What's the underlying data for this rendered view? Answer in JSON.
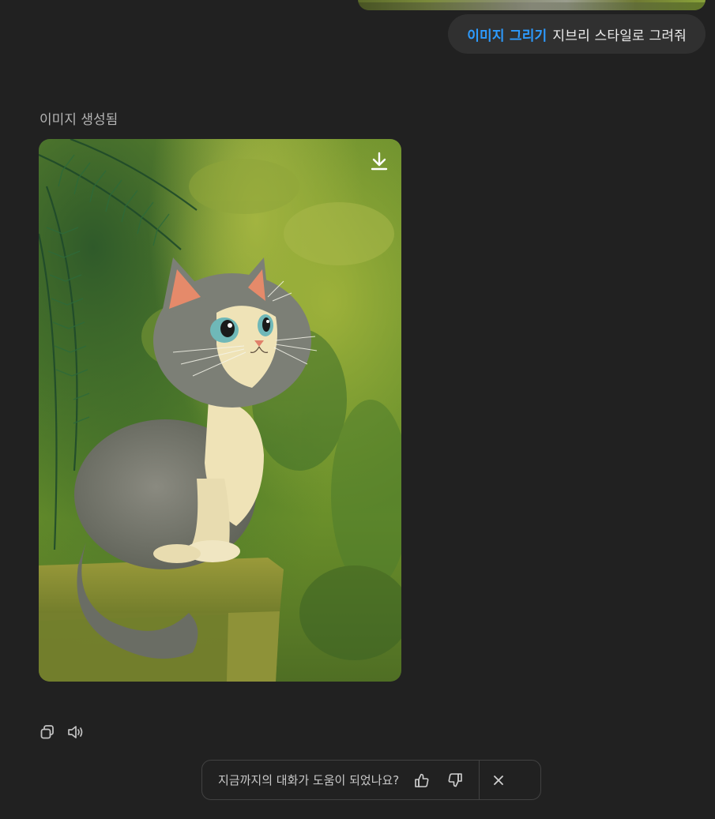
{
  "conversation": {
    "user_message": {
      "tool_tag": "이미지 그리기",
      "text": "지브리 스타일로 그려줘"
    },
    "assistant": {
      "status_label": "이미지 생성됨",
      "image": {
        "description": "Ghibli-style gray and white kitten sitting on a mossy stone pillar, looking up, with green foliage background",
        "download_icon": "download-icon"
      },
      "actions": [
        {
          "name": "copy-button",
          "icon": "copy-icon"
        },
        {
          "name": "read-aloud-button",
          "icon": "speaker-icon"
        }
      ]
    }
  },
  "feedback": {
    "question": "지금까지의 대화가 도움이 되었나요?",
    "thumbs_up_icon": "thumbs-up-icon",
    "thumbs_down_icon": "thumbs-down-icon",
    "close_icon": "close-icon"
  },
  "colors": {
    "background": "#212121",
    "bubble": "#303030",
    "accent": "#2d9bff",
    "muted_text": "#b4b4b4"
  }
}
